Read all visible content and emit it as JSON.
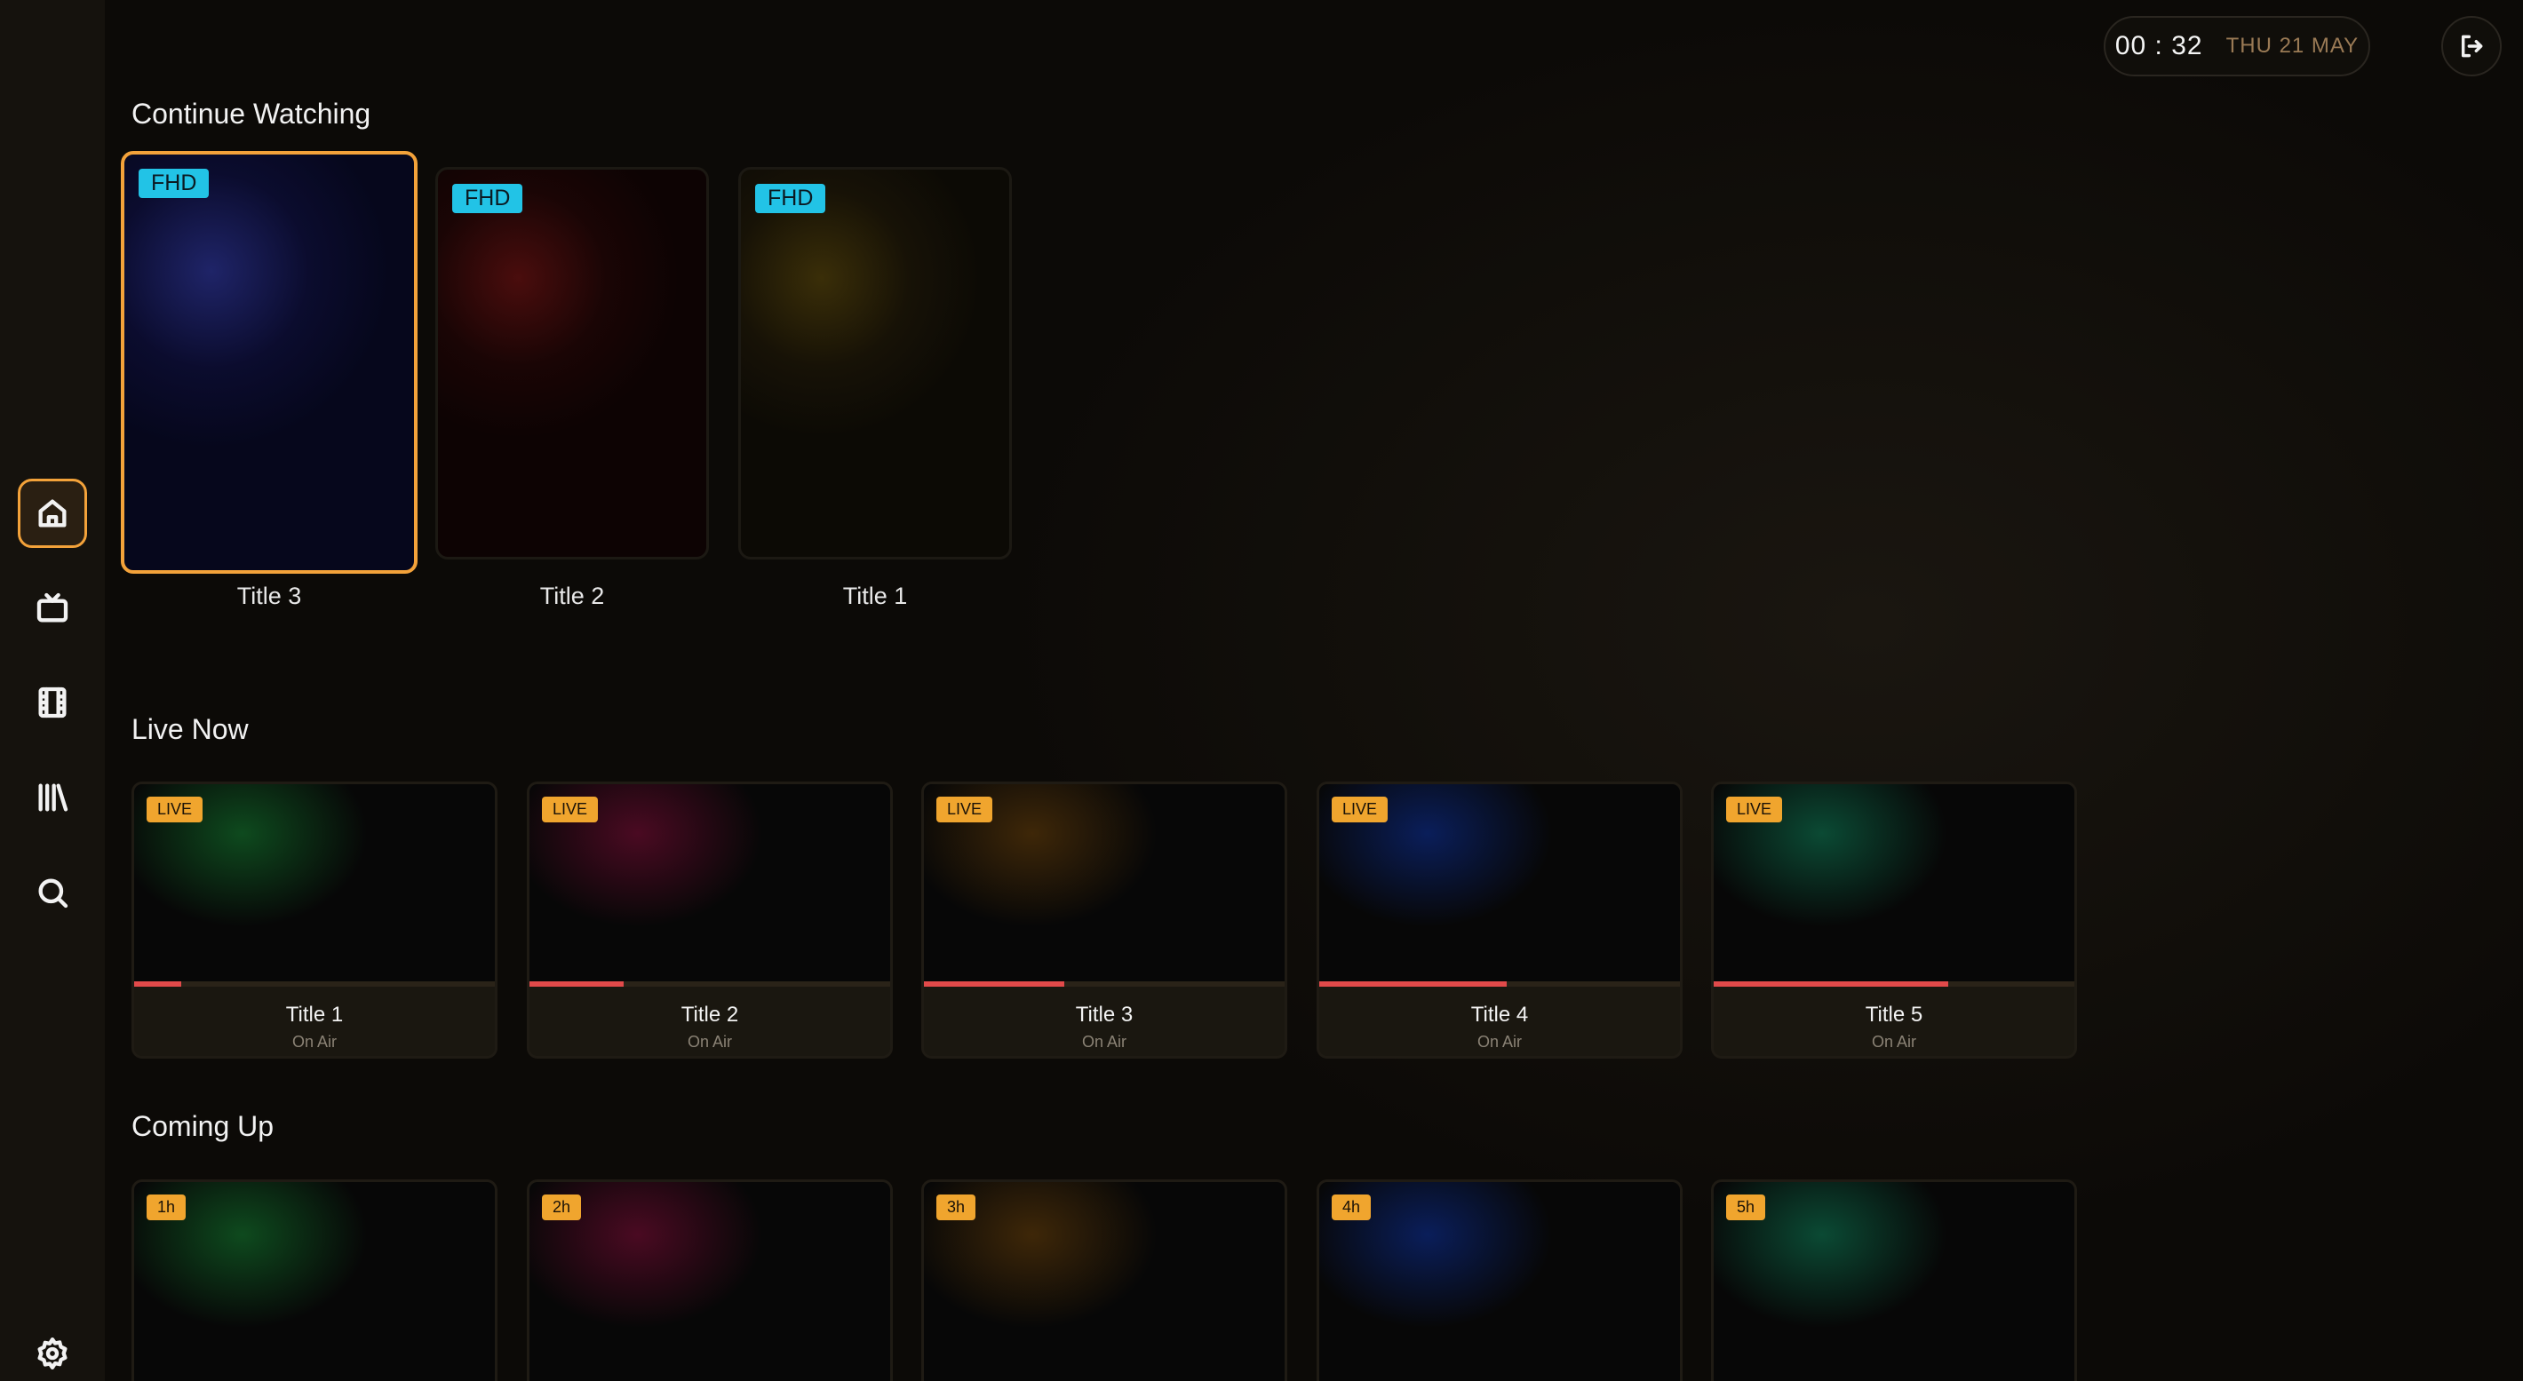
{
  "header": {
    "time": "00 : 32",
    "date": "THU 21 MAY",
    "logout_icon": "logout-icon"
  },
  "sidebar": {
    "items": [
      {
        "name": "home",
        "icon": "home-icon",
        "active": true
      },
      {
        "name": "live-tv",
        "icon": "tv-icon",
        "active": false
      },
      {
        "name": "movies",
        "icon": "film-icon",
        "active": false
      },
      {
        "name": "library",
        "icon": "library-icon",
        "active": false
      },
      {
        "name": "search",
        "icon": "search-icon",
        "active": false
      },
      {
        "name": "settings",
        "icon": "gear-icon",
        "active": false
      }
    ]
  },
  "continue_watching": {
    "title": "Continue Watching",
    "items": [
      {
        "title": "Title 3",
        "badge": "FHD",
        "color": "#1a1f6a"
      },
      {
        "title": "Title 2",
        "badge": "FHD",
        "color": "#4a0d0d"
      },
      {
        "title": "Title 1",
        "badge": "FHD",
        "color": "#3a2e08"
      }
    ]
  },
  "live_now": {
    "title": "Live Now",
    "items": [
      {
        "title": "Title 1",
        "subtitle": "On Air",
        "badge": "LIVE",
        "progress": 0.13,
        "color": "#0e4a1e"
      },
      {
        "title": "Title 2",
        "subtitle": "On Air",
        "badge": "LIVE",
        "progress": 0.26,
        "color": "#4a0a22"
      },
      {
        "title": "Title 3",
        "subtitle": "On Air",
        "badge": "LIVE",
        "progress": 0.39,
        "color": "#3e2708"
      },
      {
        "title": "Title 4",
        "subtitle": "On Air",
        "badge": "LIVE",
        "progress": 0.52,
        "color": "#0a1e5a"
      },
      {
        "title": "Title 5",
        "subtitle": "On Air",
        "badge": "LIVE",
        "progress": 0.65,
        "color": "#0b4a34"
      }
    ]
  },
  "coming_up": {
    "title": "Coming Up",
    "items": [
      {
        "badge": "1h",
        "color": "#0e4a1e"
      },
      {
        "badge": "2h",
        "color": "#4a0a22"
      },
      {
        "badge": "3h",
        "color": "#3e2708"
      },
      {
        "badge": "4h",
        "color": "#0a1e5a"
      },
      {
        "badge": "5h",
        "color": "#0b4a34"
      }
    ]
  },
  "colors": {
    "accent": "#f3a23a",
    "fhd_badge": "#22c3e6",
    "live_badge": "#f0a52e",
    "progress": "#e24a4a"
  }
}
